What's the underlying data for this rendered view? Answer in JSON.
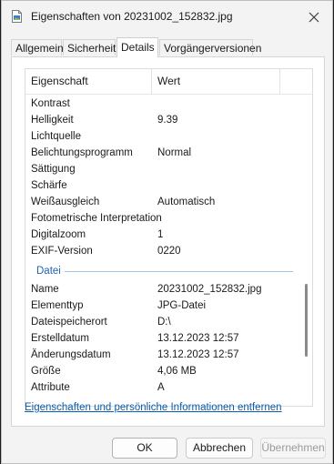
{
  "window": {
    "title": "Eigenschaften von 20231002_152832.jpg",
    "icons": {
      "file": "jpg-file-icon",
      "close": "close-icon"
    }
  },
  "tabs": [
    {
      "label": "Allgemein",
      "active": false
    },
    {
      "label": "Sicherheit",
      "active": false
    },
    {
      "label": "Details",
      "active": true
    },
    {
      "label": "Vorgängerversionen",
      "active": false
    }
  ],
  "details": {
    "columns": {
      "name": "Eigenschaft",
      "value": "Wert"
    },
    "rows_image": [
      {
        "key": "Kontrast",
        "value": ""
      },
      {
        "key": "Helligkeit",
        "value": "9.39"
      },
      {
        "key": "Lichtquelle",
        "value": ""
      },
      {
        "key": "Belichtungsprogramm",
        "value": "Normal"
      },
      {
        "key": "Sättigung",
        "value": ""
      },
      {
        "key": "Schärfe",
        "value": ""
      },
      {
        "key": "Weißausgleich",
        "value": "Automatisch"
      },
      {
        "key": "Fotometrische Interpretation",
        "value": ""
      },
      {
        "key": "Digitalzoom",
        "value": "1"
      },
      {
        "key": "EXIF-Version",
        "value": "0220"
      }
    ],
    "group_file": "Datei",
    "rows_file": [
      {
        "key": "Name",
        "value": "20231002_152832.jpg"
      },
      {
        "key": "Elementtyp",
        "value": "JPG-Datei"
      },
      {
        "key": "Dateispeicherort",
        "value": "D:\\"
      },
      {
        "key": "Erstelldatum",
        "value": "13.12.2023 12:57"
      },
      {
        "key": "Änderungsdatum",
        "value": "13.12.2023 12:57"
      },
      {
        "key": "Größe",
        "value": "4,06 MB"
      },
      {
        "key": "Attribute",
        "value": "A"
      }
    ],
    "accent_color": "#1e64b4"
  },
  "remove_link": "Eigenschaften und persönliche Informationen entfernen",
  "buttons": {
    "ok": "OK",
    "cancel": "Abbrechen",
    "apply": "Übernehmen"
  }
}
